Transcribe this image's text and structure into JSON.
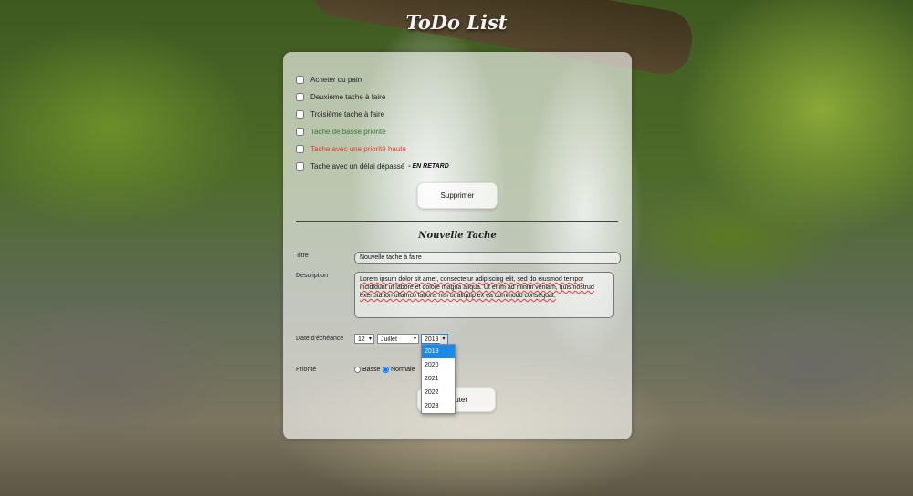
{
  "app": {
    "title": "ToDo List"
  },
  "tasks": [
    {
      "label": "Acheter du pain",
      "priority": "normal",
      "late_tag": ""
    },
    {
      "label": "Deuxième tache à faire",
      "priority": "normal",
      "late_tag": ""
    },
    {
      "label": "Troisième tache à faire",
      "priority": "normal",
      "late_tag": ""
    },
    {
      "label": "Tache de basse priorité",
      "priority": "low",
      "late_tag": ""
    },
    {
      "label": "Tache avec une priorité haute",
      "priority": "high",
      "late_tag": ""
    },
    {
      "label": "Tache avec un délai dépassé",
      "priority": "normal",
      "late_tag": "- EN RETARD"
    }
  ],
  "delete_button": {
    "label": "Supprimer"
  },
  "form": {
    "heading": "Nouvelle Tache",
    "title_label": "Titre",
    "title_value": "Nouvelle tache à faire",
    "description_label": "Description",
    "description_value": "Lorem ipsum dolor sit amet, consectetur adipiscing elit, sed do eiusmod tempor incididunt ut labore et dolore magna aliqua. Ut enim ad minim veniam, quis nostrud exercitation ullamco laboris nisi ut aliquip ex ea commodo consequat.",
    "due_date_label": "Date d'échéance",
    "day_value": "12",
    "month_value": "Juillet",
    "year_value": "2019",
    "year_options": [
      "2019",
      "2020",
      "2021",
      "2022",
      "2023"
    ],
    "priority_label": "Priorité",
    "priority_options": [
      "Basse",
      "Normale"
    ],
    "priority_selected": "Normale",
    "add_button_label": "Ajouter",
    "add_button_visible_text": "outer"
  },
  "colors": {
    "low_priority": "#2e7d32",
    "high_priority": "#e53935",
    "dropdown_highlight": "#1e88e5"
  }
}
